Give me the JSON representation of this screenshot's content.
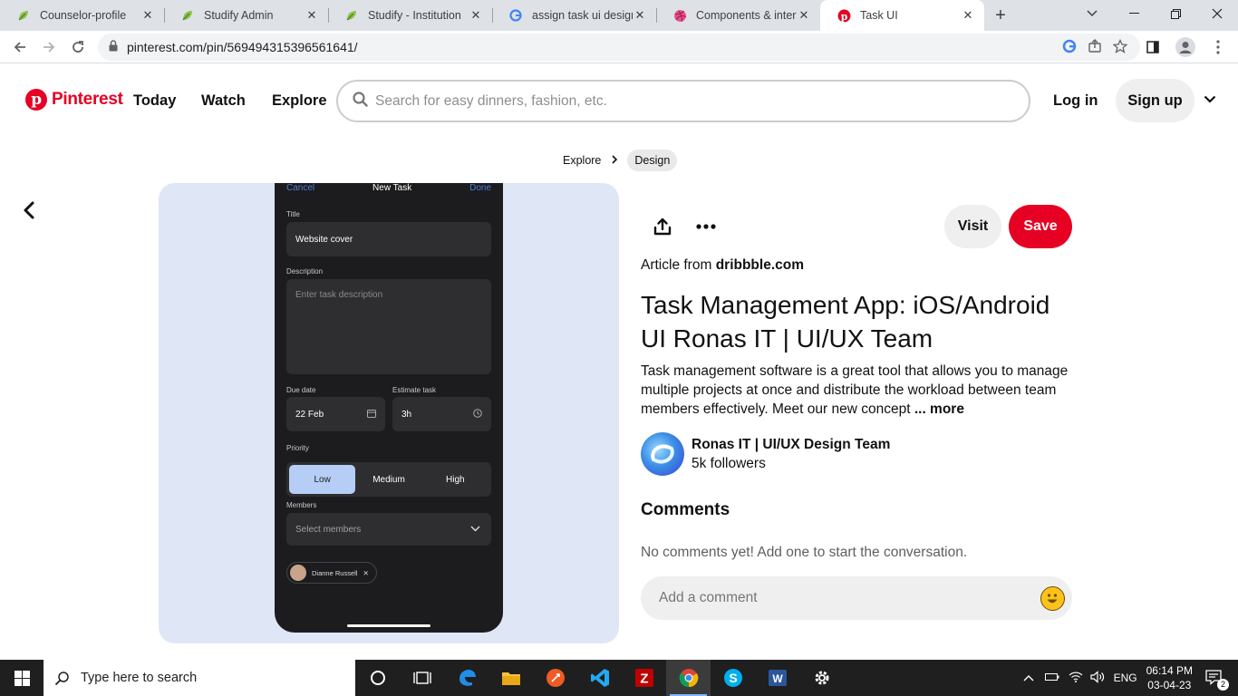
{
  "browser": {
    "tabs": [
      {
        "title": "Counselor-profile",
        "favicon": "leaf-icon"
      },
      {
        "title": "Studify Admin",
        "favicon": "leaf-icon"
      },
      {
        "title": "Studify - Institution",
        "favicon": "leaf-icon"
      },
      {
        "title": "assign task ui design -",
        "favicon": "google-icon"
      },
      {
        "title": "Components & interac",
        "favicon": "dribbble-icon"
      },
      {
        "title": "Task UI",
        "favicon": "pinterest-icon",
        "active": true
      }
    ],
    "url": "pinterest.com/pin/569494315396561641/"
  },
  "pinterest": {
    "logo": "Pinterest",
    "nav": {
      "today": "Today",
      "watch": "Watch",
      "explore": "Explore"
    },
    "search_placeholder": "Search for easy dinners, fashion, etc.",
    "login": "Log in",
    "signup": "Sign up",
    "breadcrumb": {
      "explore": "Explore",
      "category": "Design"
    },
    "pin": {
      "visit": "Visit",
      "save": "Save",
      "article_prefix": "Article from",
      "domain": "dribbble.com",
      "title": "Task Management App: iOS/Android UI Ronas IT | UI/UX Team",
      "description": "Task management software is a great tool that allows you to manage multiple projects at once and distribute the workload between team members effectively. Meet our new concept",
      "more": "... more",
      "creator": {
        "name": "Ronas IT | UI/UX Design Team",
        "followers": "5k followers"
      },
      "comments_heading": "Comments",
      "comments_empty": "No comments yet! Add one to start the conversation.",
      "comment_placeholder": "Add a comment"
    },
    "phone": {
      "cancel": "Cancel",
      "header": "New Task",
      "done": "Done",
      "title_label": "Title",
      "title_value": "Website cover",
      "desc_label": "Description",
      "desc_placeholder": "Enter task description",
      "due_label": "Due date",
      "due_value": "22 Feb",
      "estimate_label": "Estimate task",
      "estimate_value": "3h",
      "priority_label": "Priority",
      "priorities": [
        "Low",
        "Medium",
        "High"
      ],
      "members_label": "Members",
      "members_placeholder": "Select members",
      "member_chip": "Dianne Russell"
    }
  },
  "taskbar": {
    "search_placeholder": "Type here to search",
    "lang": "ENG",
    "time": "06:14 PM",
    "date": "03-04-23",
    "notifications": "2"
  },
  "colors": {
    "pinterest_red": "#e60023",
    "pin_bg": "#dfe6f6",
    "accent_blue": "#4f7dd6"
  }
}
